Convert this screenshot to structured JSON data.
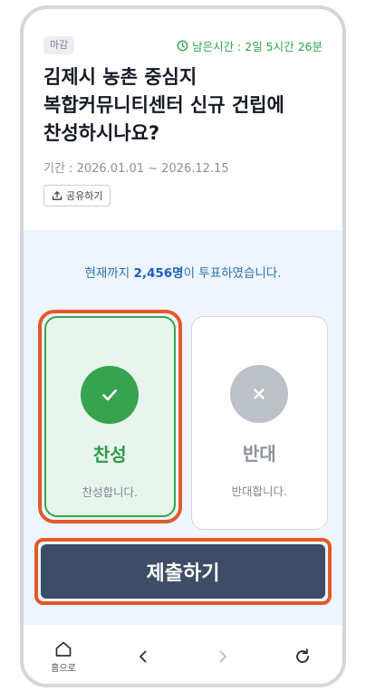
{
  "poll": {
    "status_badge": "마감",
    "time_remaining": "남은시간 : 2일 5시간 26분",
    "title_line1": "김제시 농촌 중심지",
    "title_line2": "복합커뮤니티센터 신규 건립에",
    "title_line3": "찬성하시나요?",
    "period": "기간 : 2026.01.01 ~ 2026.12.15",
    "share_label": "공유하기"
  },
  "votes": {
    "prefix": "현재까지 ",
    "count": "2,456명",
    "suffix": "이 투표하였습니다."
  },
  "options": [
    {
      "title": "찬성",
      "desc": "찬성합니다.",
      "icon": "check-icon",
      "selected": true
    },
    {
      "title": "반대",
      "desc": "반대합니다.",
      "icon": "close-icon",
      "selected": false
    }
  ],
  "submit_label": "제출하기",
  "nav": {
    "home_label": "홈으로"
  },
  "colors": {
    "accent_green": "#37a34f",
    "submit_bg": "#3e4d67",
    "highlight_orange": "#e25a2c",
    "vote_area_bg": "#eef5fd"
  }
}
